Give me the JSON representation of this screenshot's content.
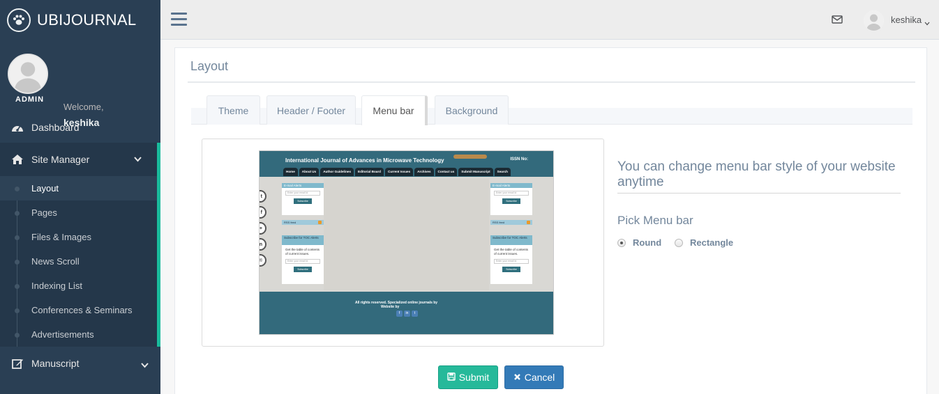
{
  "app": {
    "title": "UBIJOURNAL"
  },
  "profile": {
    "welcome": "Welcome,",
    "name": "keshika",
    "role": "ADMIN"
  },
  "sidebar": {
    "dashboard": "Dashboard",
    "site_manager": {
      "label": "Site Manager",
      "items": [
        "Layout",
        "Pages",
        "Files & Images",
        "News Scroll",
        "Indexing List",
        "Conferences & Seminars",
        "Advertisements"
      ],
      "active": "Layout"
    },
    "manuscript": "Manuscript"
  },
  "topnav": {
    "user": "keshika"
  },
  "page": {
    "title": "Layout",
    "tabs": [
      "Theme",
      "Header / Footer",
      "Menu bar",
      "Background"
    ],
    "active_tab": "Menu bar"
  },
  "preview": {
    "journal_title": "International Journal of Advances in Microwave Technology",
    "issn": "ISSN No:",
    "nav": [
      "Home",
      "About Us",
      "Author Guidelines",
      "Editorial Board",
      "Current Issues",
      "Archives",
      "Contact us",
      "Submit Manuscript",
      "Search"
    ],
    "email_alerts": "E-mail Alerts",
    "email_placeholder": "Enter your email Id",
    "subscribe": "Subscribe",
    "rss_feed": "RSS feed",
    "toc_heading": "Subscribe for TOC Alerts",
    "toc_text": "Get the table of contents of current issues.",
    "footer_line1": "All rights reserved. Specialized online journals by",
    "footer_line2": "Website by"
  },
  "settings": {
    "heading": "You can change menu bar style of your website anytime",
    "pick_label": "Pick Menu bar",
    "options": [
      "Round",
      "Rectangle"
    ],
    "selected": "Round"
  },
  "actions": {
    "submit": "Submit",
    "cancel": "Cancel"
  },
  "colors": {
    "sidebar": "#2a3f54",
    "accent": "#1abb9c",
    "submit": "#26b99a",
    "cancel": "#337ab7"
  }
}
